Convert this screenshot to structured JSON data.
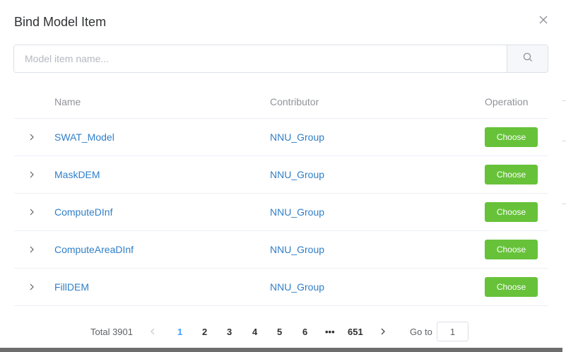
{
  "dialog": {
    "title": "Bind Model Item",
    "close_icon": "close-icon"
  },
  "search": {
    "placeholder": "Model item name...",
    "value": "",
    "icon": "search-icon"
  },
  "table": {
    "columns": [
      "Name",
      "Contributor",
      "Operation"
    ],
    "rows": [
      {
        "name": "SWAT_Model",
        "contributor": "NNU_Group",
        "action": "Choose"
      },
      {
        "name": "MaskDEM",
        "contributor": "NNU_Group",
        "action": "Choose"
      },
      {
        "name": "ComputeDInf",
        "contributor": "NNU_Group",
        "action": "Choose"
      },
      {
        "name": "ComputeAreaDInf",
        "contributor": "NNU_Group",
        "action": "Choose"
      },
      {
        "name": "FillDEM",
        "contributor": "NNU_Group",
        "action": "Choose"
      }
    ]
  },
  "pagination": {
    "total": "Total 3901",
    "pages": [
      "1",
      "2",
      "3",
      "4",
      "5",
      "6",
      "•••",
      "651"
    ],
    "current": "1",
    "goto_label": "Go to",
    "goto_value": "1"
  },
  "colors": {
    "accent": "#409eff",
    "link": "#2f7fc8",
    "button": "#67c23a"
  }
}
